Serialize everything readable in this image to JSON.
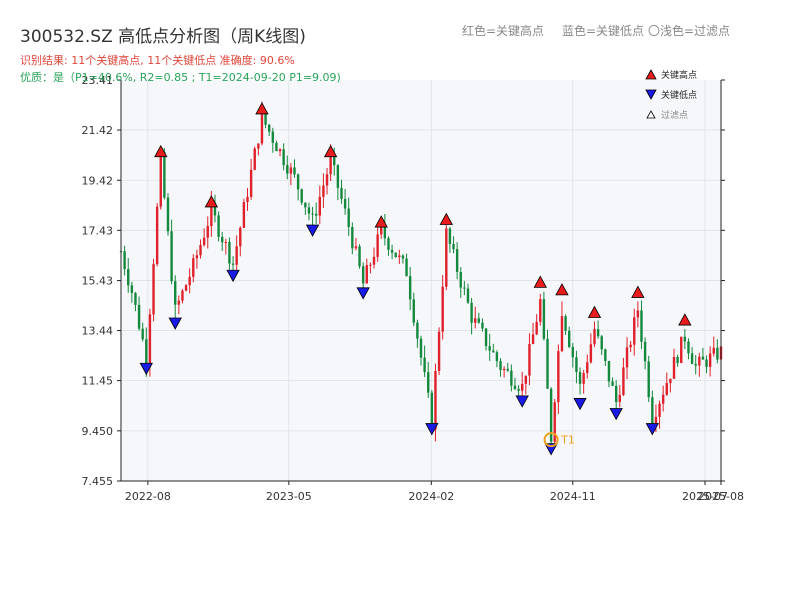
{
  "header": {
    "title": "300532.SZ 高低点分析图（周K线图)",
    "line1": "识别结果: 11个关键高点, 11个关键低点   准确度: 90.6%",
    "line2": "优质：是（P1=40.6%, R2=0.85 ; T1=2024-09-20 P1=9.09)",
    "legend_top": [
      "红色=关键高点",
      "蓝色=关键低点",
      "〇浅色=过滤点"
    ]
  },
  "legend": [
    {
      "label": "关键高点",
      "color": "#e81c1c",
      "shape": "triangle-up"
    },
    {
      "label": "关键低点",
      "color": "#1a1ae6",
      "shape": "triangle-down"
    },
    {
      "label": "过滤点",
      "color": "#ffffff",
      "shape": "triangle-up-outline"
    }
  ],
  "colors": {
    "up": "#e0202a",
    "down": "#14883c",
    "high": "#e81c1c",
    "low": "#1a1ae6",
    "t1": "#f0a020",
    "background": "#f5f7fa"
  },
  "chart_data": {
    "type": "candlestick",
    "xlabel": "",
    "ylabel": "",
    "ylim": [
      7.455,
      23.41
    ],
    "xlim": [
      "2022-06-10",
      "2025-08-15"
    ],
    "yticks": [
      "7.455",
      "9.450",
      "11.45",
      "13.44",
      "15.43",
      "17.43",
      "19.42",
      "21.42",
      "23.41"
    ],
    "xticks": [
      {
        "date": "2022-08-01",
        "label": "2022-08"
      },
      {
        "date": "2023-05-01",
        "label": "2023-05"
      },
      {
        "date": "2024-02-01",
        "label": "2024-02"
      },
      {
        "date": "2024-11-01",
        "label": "2024-11"
      },
      {
        "date": "2025-07-15",
        "label": "2025-07"
      },
      {
        "date": "2025-08-15",
        "label": "2025-08"
      }
    ],
    "anchors": [
      [
        "2022-06-10",
        16.6
      ],
      [
        "2022-07-01",
        15.0
      ],
      [
        "2022-07-29",
        12.4
      ],
      [
        "2022-08-26",
        20.2
      ],
      [
        "2022-09-23",
        14.2
      ],
      [
        "2022-10-28",
        16.0
      ],
      [
        "2022-12-02",
        18.2
      ],
      [
        "2023-01-13",
        16.1
      ],
      [
        "2023-03-10",
        21.9
      ],
      [
        "2023-05-12",
        19.5
      ],
      [
        "2023-06-16",
        17.8
      ],
      [
        "2023-07-21",
        20.2
      ],
      [
        "2023-08-25",
        17.6
      ],
      [
        "2023-09-22",
        15.3
      ],
      [
        "2023-10-27",
        17.4
      ],
      [
        "2023-12-15",
        15.8
      ],
      [
        "2024-02-02",
        9.8
      ],
      [
        "2024-03-01",
        17.3
      ],
      [
        "2024-04-19",
        14.0
      ],
      [
        "2024-06-14",
        12.0
      ],
      [
        "2024-07-26",
        11.2
      ],
      [
        "2024-08-30",
        14.6
      ],
      [
        "2024-09-20",
        9.2
      ],
      [
        "2024-10-11",
        14.3
      ],
      [
        "2024-11-15",
        11.2
      ],
      [
        "2024-12-13",
        13.5
      ],
      [
        "2025-01-24",
        10.6
      ],
      [
        "2025-03-07",
        14.3
      ],
      [
        "2025-04-04",
        10.0
      ],
      [
        "2025-06-06",
        13.2
      ],
      [
        "2025-06-27",
        12.0
      ],
      [
        "2025-08-15",
        12.6
      ]
    ],
    "highs": [
      {
        "date": "2022-08-26",
        "value": 20.2
      },
      {
        "date": "2022-12-02",
        "value": 18.2
      },
      {
        "date": "2023-03-10",
        "value": 21.9
      },
      {
        "date": "2023-07-21",
        "value": 20.2
      },
      {
        "date": "2023-10-27",
        "value": 17.4
      },
      {
        "date": "2024-03-01",
        "value": 17.5
      },
      {
        "date": "2024-08-30",
        "value": 15.0
      },
      {
        "date": "2024-10-11",
        "value": 14.7
      },
      {
        "date": "2024-12-13",
        "value": 13.8
      },
      {
        "date": "2025-03-07",
        "value": 14.6
      },
      {
        "date": "2025-06-06",
        "value": 13.5
      }
    ],
    "lows": [
      {
        "date": "2022-07-29",
        "value": 12.3
      },
      {
        "date": "2022-09-23",
        "value": 14.1
      },
      {
        "date": "2023-01-13",
        "value": 16.0
      },
      {
        "date": "2023-06-16",
        "value": 17.8
      },
      {
        "date": "2023-09-22",
        "value": 15.3
      },
      {
        "date": "2024-02-02",
        "value": 9.9
      },
      {
        "date": "2024-07-26",
        "value": 11.0
      },
      {
        "date": "2024-09-20",
        "value": 9.1
      },
      {
        "date": "2024-11-15",
        "value": 10.9
      },
      {
        "date": "2025-01-24",
        "value": 10.5
      },
      {
        "date": "2025-04-04",
        "value": 9.9
      }
    ],
    "t1": {
      "date": "2024-09-20",
      "value": 9.1,
      "label": "T1"
    }
  }
}
